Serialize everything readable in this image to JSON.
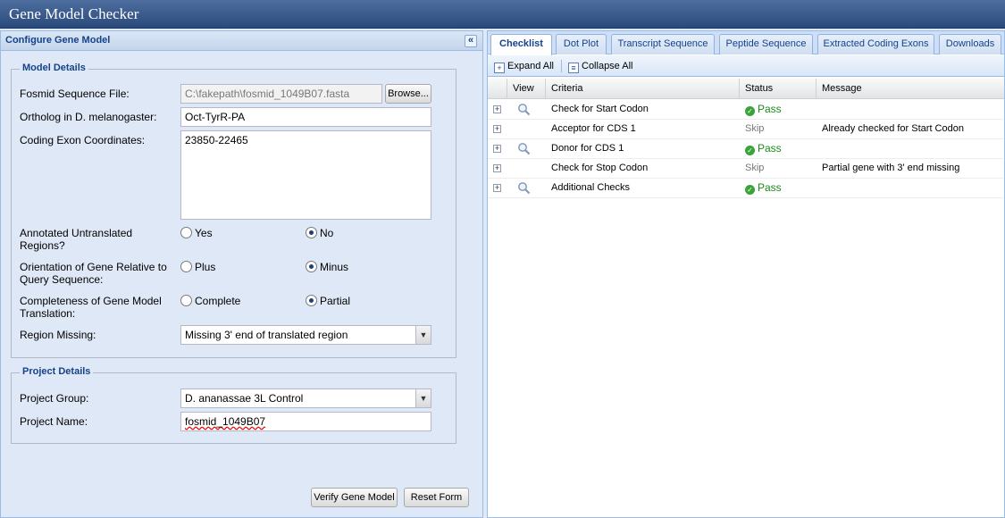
{
  "app": {
    "title": "Gene Model Checker"
  },
  "left": {
    "title": "Configure Gene Model",
    "collapse_icon": "«",
    "model_details": {
      "legend": "Model Details",
      "fosmid_label": "Fosmid Sequence File:",
      "fosmid_value": "C:\\fakepath\\fosmid_1049B07.fasta",
      "browse_label": "Browse...",
      "ortholog_label": "Ortholog in D. melanogaster:",
      "ortholog_value": "Oct-TyrR-PA",
      "coords_label": "Coding Exon Coordinates:",
      "coords_value": "23850-22465",
      "utr_label": "Annotated Untranslated Regions?",
      "utr_yes": "Yes",
      "utr_no": "No",
      "utr_selected": "No",
      "orient_label": "Orientation of Gene Relative to Query Sequence:",
      "orient_plus": "Plus",
      "orient_minus": "Minus",
      "orient_selected": "Minus",
      "complete_label": "Completeness of Gene Model Translation:",
      "complete_complete": "Complete",
      "complete_partial": "Partial",
      "complete_selected": "Partial",
      "region_label": "Region Missing:",
      "region_value": "Missing 3' end of translated region"
    },
    "project_details": {
      "legend": "Project Details",
      "group_label": "Project Group:",
      "group_value": "D. ananassae 3L Control",
      "name_label": "Project Name:",
      "name_value": "fosmid_1049B07"
    },
    "buttons": {
      "verify": "Verify Gene Model",
      "reset": "Reset Form"
    }
  },
  "right": {
    "tabs": [
      {
        "label": "Checklist",
        "active": true
      },
      {
        "label": "Dot Plot",
        "active": false
      },
      {
        "label": "Transcript Sequence",
        "active": false
      },
      {
        "label": "Peptide Sequence",
        "active": false
      },
      {
        "label": "Extracted Coding Exons",
        "active": false
      },
      {
        "label": "Downloads",
        "active": false
      }
    ],
    "toolbar": {
      "expand": "Expand All",
      "collapse": "Collapse All"
    },
    "columns": {
      "view": "View",
      "criteria": "Criteria",
      "status": "Status",
      "message": "Message"
    },
    "rows": [
      {
        "criteria": "Check for Start Codon",
        "status": "Pass",
        "message": "",
        "has_view": true
      },
      {
        "criteria": "Acceptor for CDS 1",
        "status": "Skip",
        "message": "Already checked for Start Codon",
        "has_view": false
      },
      {
        "criteria": "Donor for CDS 1",
        "status": "Pass",
        "message": "",
        "has_view": true
      },
      {
        "criteria": "Check for Stop Codon",
        "status": "Skip",
        "message": "Partial gene with 3' end missing",
        "has_view": false
      },
      {
        "criteria": "Additional Checks",
        "status": "Pass",
        "message": "",
        "has_view": true
      }
    ]
  },
  "icons": {
    "expander": "plus-box-icon",
    "view": "magnifier-icon",
    "pass": "check-circle-icon"
  },
  "colors": {
    "header": "#2b4a7c",
    "panel_bg": "#dfe8f6",
    "accent": "#15428b",
    "pass": "#1a8a1a"
  }
}
